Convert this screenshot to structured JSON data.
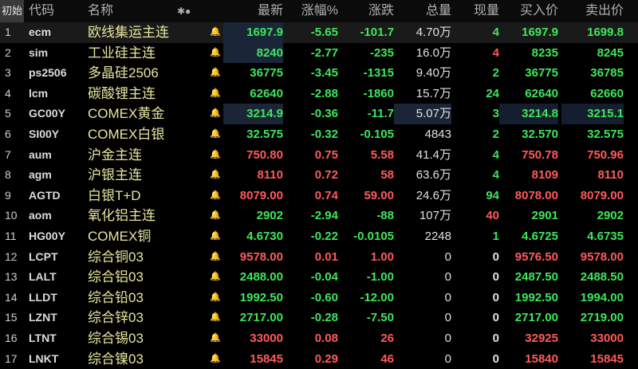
{
  "header": {
    "first": "初始",
    "code": "代码",
    "name": "名称",
    "icons": "✱●",
    "price": "最新",
    "chg_pct": "涨幅%",
    "chg": "涨跌",
    "vol": "总量",
    "cur": "现量",
    "bid": "买入价",
    "ask": "卖出价"
  },
  "colors": {
    "up": "#ff5a5a",
    "down": "#3ee65a",
    "name": "#e6e6a0"
  },
  "rows": [
    {
      "idx": "1",
      "code": "ecm",
      "name": "欧线集运主连",
      "price": "1697.9",
      "chg_pct": "-5.65",
      "chg": "-101.7",
      "vol": "4.70万",
      "cur": "4",
      "bid": "1697.9",
      "ask": "1699.8",
      "dir": "down",
      "alert": false
    },
    {
      "idx": "2",
      "code": "sim",
      "name": "工业硅主连",
      "price": "8240",
      "chg_pct": "-2.77",
      "chg": "-235",
      "vol": "16.0万",
      "cur": "4",
      "bid": "8235",
      "ask": "8245",
      "dir": "down",
      "alert": false
    },
    {
      "idx": "3",
      "code": "ps2506",
      "name": "多晶硅2506",
      "price": "36775",
      "chg_pct": "-3.45",
      "chg": "-1315",
      "vol": "9.40万",
      "cur": "2",
      "bid": "36775",
      "ask": "36785",
      "dir": "down",
      "alert": false
    },
    {
      "idx": "4",
      "code": "lcm",
      "name": "碳酸锂主连",
      "price": "62640",
      "chg_pct": "-2.88",
      "chg": "-1860",
      "vol": "15.7万",
      "cur": "24",
      "bid": "62640",
      "ask": "62660",
      "dir": "down",
      "alert": true
    },
    {
      "idx": "5",
      "code": "GC00Y",
      "name": "COMEX黄金",
      "price": "3214.9",
      "chg_pct": "-0.36",
      "chg": "-11.7",
      "vol": "5.07万",
      "cur": "3",
      "bid": "3214.8",
      "ask": "3215.1",
      "dir": "down",
      "alert": false
    },
    {
      "idx": "6",
      "code": "SI00Y",
      "name": "COMEX白银",
      "price": "32.575",
      "chg_pct": "-0.32",
      "chg": "-0.105",
      "vol": "4843",
      "cur": "2",
      "bid": "32.570",
      "ask": "32.575",
      "dir": "down",
      "alert": false
    },
    {
      "idx": "7",
      "code": "aum",
      "name": "沪金主连",
      "price": "750.80",
      "chg_pct": "0.75",
      "chg": "5.58",
      "vol": "41.4万",
      "cur": "4",
      "bid": "750.78",
      "ask": "750.96",
      "dir": "up",
      "alert": false
    },
    {
      "idx": "8",
      "code": "agm",
      "name": "沪银主连",
      "price": "8110",
      "chg_pct": "0.72",
      "chg": "58",
      "vol": "63.6万",
      "cur": "4",
      "bid": "8109",
      "ask": "8110",
      "dir": "up",
      "alert": false
    },
    {
      "idx": "9",
      "code": "AGTD",
      "name": "白银T+D",
      "price": "8079.00",
      "chg_pct": "0.74",
      "chg": "59.00",
      "vol": "24.6万",
      "cur": "94",
      "bid": "8078.00",
      "ask": "8079.00",
      "dir": "up",
      "alert": false
    },
    {
      "idx": "10",
      "code": "aom",
      "name": "氧化铝主连",
      "price": "2902",
      "chg_pct": "-2.94",
      "chg": "-88",
      "vol": "107万",
      "cur": "40",
      "bid": "2901",
      "ask": "2902",
      "dir": "down",
      "alert": false
    },
    {
      "idx": "11",
      "code": "HG00Y",
      "name": "COMEX铜",
      "price": "4.6730",
      "chg_pct": "-0.22",
      "chg": "-0.0105",
      "vol": "2248",
      "cur": "1",
      "bid": "4.6725",
      "ask": "4.6735",
      "dir": "down",
      "alert": false
    },
    {
      "idx": "12",
      "code": "LCPT",
      "name": "综合铜03",
      "price": "9578.00",
      "chg_pct": "0.01",
      "chg": "1.00",
      "vol": "0",
      "cur": "0",
      "bid": "9576.50",
      "ask": "9578.00",
      "dir": "up",
      "alert": false
    },
    {
      "idx": "13",
      "code": "LALT",
      "name": "综合铝03",
      "price": "2488.00",
      "chg_pct": "-0.04",
      "chg": "-1.00",
      "vol": "0",
      "cur": "0",
      "bid": "2487.50",
      "ask": "2488.50",
      "dir": "down",
      "alert": false
    },
    {
      "idx": "14",
      "code": "LLDT",
      "name": "综合铅03",
      "price": "1992.50",
      "chg_pct": "-0.60",
      "chg": "-12.00",
      "vol": "0",
      "cur": "0",
      "bid": "1992.50",
      "ask": "1994.00",
      "dir": "down",
      "alert": false
    },
    {
      "idx": "15",
      "code": "LZNT",
      "name": "综合锌03",
      "price": "2717.00",
      "chg_pct": "-0.28",
      "chg": "-7.50",
      "vol": "0",
      "cur": "0",
      "bid": "2717.00",
      "ask": "2719.00",
      "dir": "down",
      "alert": false
    },
    {
      "idx": "16",
      "code": "LTNT",
      "name": "综合锡03",
      "price": "33000",
      "chg_pct": "0.08",
      "chg": "26",
      "vol": "0",
      "cur": "0",
      "bid": "32925",
      "ask": "33000",
      "dir": "up",
      "alert": false
    },
    {
      "idx": "17",
      "code": "LNKT",
      "name": "综合镍03",
      "price": "15845",
      "chg_pct": "0.29",
      "chg": "46",
      "vol": "0",
      "cur": "0",
      "bid": "15840",
      "ask": "15845",
      "dir": "up",
      "alert": false
    }
  ]
}
